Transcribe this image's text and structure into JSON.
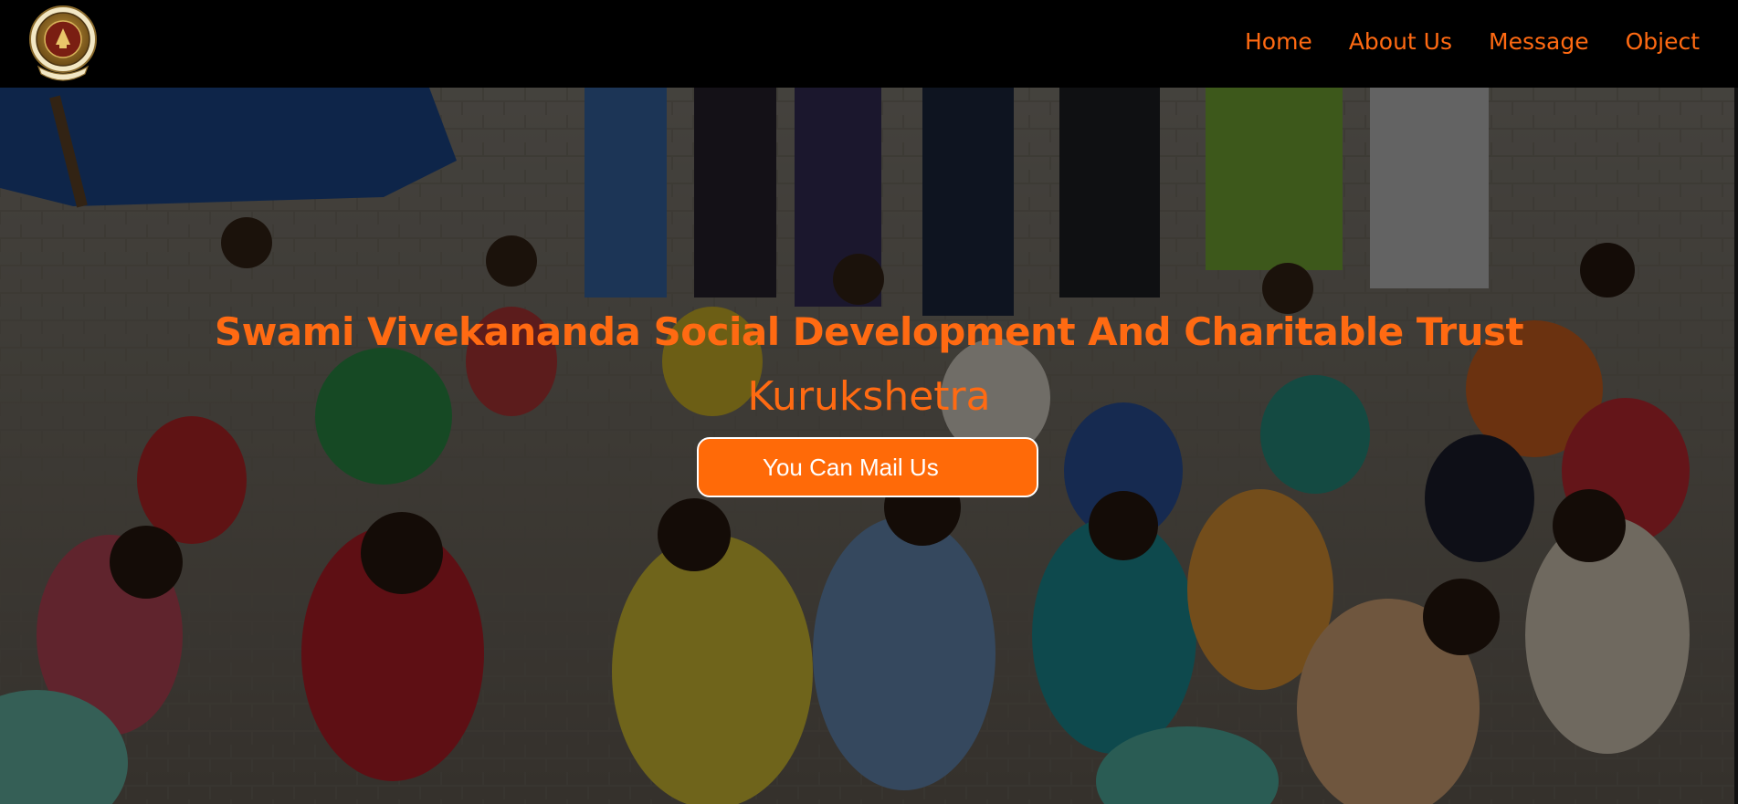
{
  "header": {
    "logo_icon": "trust-emblem-logo",
    "nav": [
      {
        "label": "Home"
      },
      {
        "label": "About Us"
      },
      {
        "label": "Message"
      },
      {
        "label": "Object"
      }
    ]
  },
  "hero": {
    "background_image": "children-seated-with-books-outdoors",
    "title": "Swami Vivekananda Social Development And Charitable Trust",
    "subtitle": "Kurukshetra",
    "cta_label": "You Can Mail Us"
  },
  "colors": {
    "accent": "#ff6a12",
    "button": "#ff6a08",
    "navbar": "#000000"
  }
}
